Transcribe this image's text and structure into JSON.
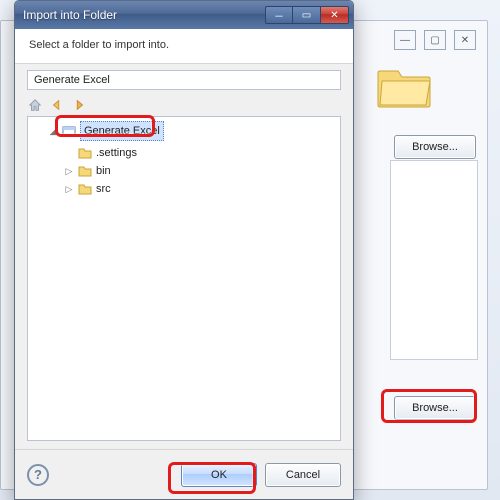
{
  "dialog": {
    "title": "Import into Folder",
    "banner": "Select a folder to import into.",
    "path_value": "Generate Excel",
    "toolbar": {
      "home": "home-icon",
      "back": "back-icon",
      "forward": "forward-icon"
    },
    "tree": {
      "root": {
        "label": "Generate Excel",
        "children": [
          {
            "label": ".settings"
          },
          {
            "label": "bin"
          },
          {
            "label": "src"
          }
        ]
      }
    },
    "buttons": {
      "ok": "OK",
      "cancel": "Cancel"
    }
  },
  "background": {
    "browse1": "Browse...",
    "browse2": "Browse...",
    "win_min": "—",
    "win_max": "▢",
    "win_close": "✕"
  },
  "colors": {
    "highlight": "#e21b1b",
    "selection": "#cfe3ff"
  }
}
